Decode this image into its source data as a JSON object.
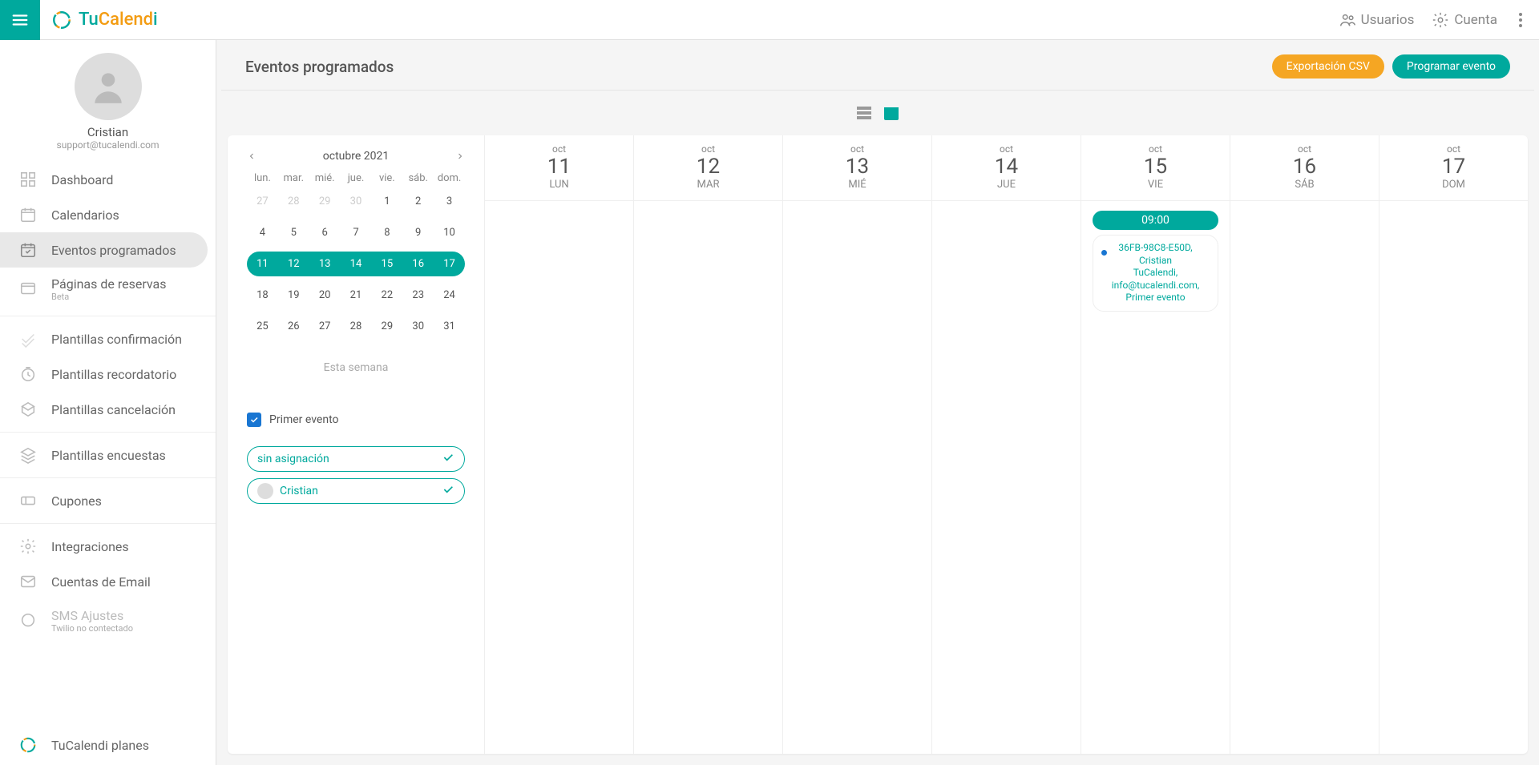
{
  "brand": {
    "tu": "Tu",
    "cal": "Calend",
    "i": "i"
  },
  "topbar": {
    "users": "Usuarios",
    "account": "Cuenta"
  },
  "profile": {
    "name": "Cristian",
    "email": "support@tucalendi.com"
  },
  "nav": {
    "dashboard": "Dashboard",
    "calendars": "Calendarios",
    "events": "Eventos programados",
    "booking": "Páginas de reservas",
    "booking_sub": "Beta",
    "confirm": "Plantillas confirmación",
    "reminder": "Plantillas recordatorio",
    "cancel": "Plantillas cancelación",
    "surveys": "Plantillas encuestas",
    "coupons": "Cupones",
    "integrations": "Integraciones",
    "emailacc": "Cuentas de Email",
    "sms": "SMS Ajustes",
    "sms_sub": "Twilio no contectado",
    "plans": "TuCalendi planes"
  },
  "page": {
    "title": "Eventos programados",
    "export": "Exportación CSV",
    "schedule": "Programar evento"
  },
  "minical": {
    "title": "octubre 2021",
    "dow": [
      "lun.",
      "mar.",
      "mié.",
      "jue.",
      "vie.",
      "sáb.",
      "dom."
    ],
    "weeks": [
      [
        {
          "n": "27",
          "m": true
        },
        {
          "n": "28",
          "m": true
        },
        {
          "n": "29",
          "m": true
        },
        {
          "n": "30",
          "m": true
        },
        {
          "n": "1"
        },
        {
          "n": "2"
        },
        {
          "n": "3"
        }
      ],
      [
        {
          "n": "4"
        },
        {
          "n": "5"
        },
        {
          "n": "6"
        },
        {
          "n": "7"
        },
        {
          "n": "8"
        },
        {
          "n": "9"
        },
        {
          "n": "10"
        }
      ],
      [
        {
          "n": "11",
          "s": "first"
        },
        {
          "n": "12",
          "s": "mid"
        },
        {
          "n": "13",
          "s": "mid"
        },
        {
          "n": "14",
          "s": "mid"
        },
        {
          "n": "15",
          "s": "mid"
        },
        {
          "n": "16",
          "s": "mid"
        },
        {
          "n": "17",
          "s": "last"
        }
      ],
      [
        {
          "n": "18"
        },
        {
          "n": "19"
        },
        {
          "n": "20"
        },
        {
          "n": "21"
        },
        {
          "n": "22"
        },
        {
          "n": "23"
        },
        {
          "n": "24"
        }
      ],
      [
        {
          "n": "25"
        },
        {
          "n": "26"
        },
        {
          "n": "27"
        },
        {
          "n": "28"
        },
        {
          "n": "29"
        },
        {
          "n": "30"
        },
        {
          "n": "31"
        }
      ]
    ],
    "today": "Esta semana"
  },
  "filters": {
    "primer": "Primer evento",
    "unassigned": "sin asignación",
    "user1": "Cristian"
  },
  "week": {
    "month": "oct",
    "days": [
      {
        "num": "11",
        "dow": "LUN"
      },
      {
        "num": "12",
        "dow": "MAR"
      },
      {
        "num": "13",
        "dow": "MIÉ"
      },
      {
        "num": "14",
        "dow": "JUE"
      },
      {
        "num": "15",
        "dow": "VIE"
      },
      {
        "num": "16",
        "dow": "SÁB"
      },
      {
        "num": "17",
        "dow": "DOM"
      }
    ],
    "event": {
      "day_index": 4,
      "time": "09:00",
      "line1": "36FB-98C8-E50D, Cristian",
      "line2": "TuCalendi,",
      "line3": "info@tucalendi.com,",
      "line4": "Primer evento"
    }
  }
}
